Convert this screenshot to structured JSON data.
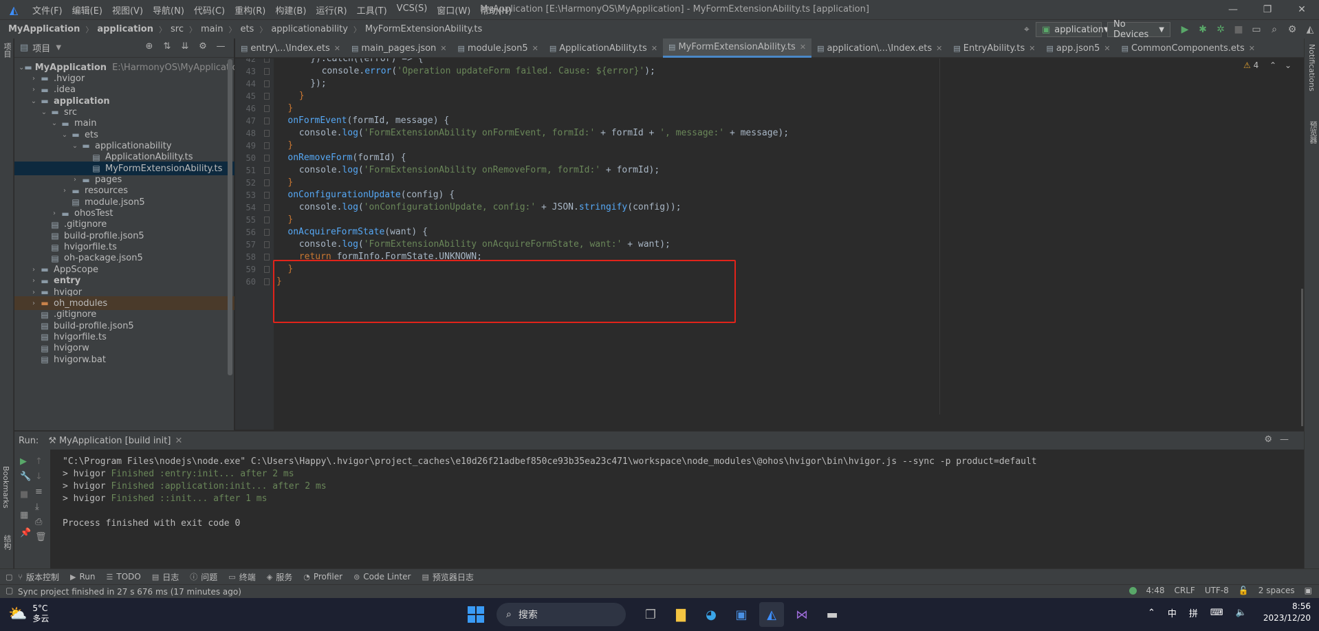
{
  "menubar": {
    "items": [
      "文件(F)",
      "编辑(E)",
      "视图(V)",
      "导航(N)",
      "代码(C)",
      "重构(R)",
      "构建(B)",
      "运行(R)",
      "工具(T)",
      "VCS(S)",
      "窗口(W)",
      "帮助(H)"
    ],
    "window_title": "MyApplication [E:\\HarmonyOS\\MyApplication] - MyFormExtensionAbility.ts [application]",
    "minimize": "—",
    "restore": "❐",
    "close": "✕"
  },
  "navbar": {
    "breadcrumbs": [
      "MyApplication",
      "application",
      "src",
      "main",
      "ets",
      "applicationability",
      "MyFormExtensionAbility.ts"
    ],
    "run_config": "application",
    "device": "No Devices"
  },
  "left_strip": {
    "project_tab": "项目",
    "bookmarks_tab": "Bookmarks",
    "structure_tab": "结构"
  },
  "right_strip": {
    "notifications_tab": "Notifications",
    "preview_tab": "预览器"
  },
  "project_panel": {
    "title": "项目",
    "tree": [
      {
        "label": "MyApplication",
        "path": "E:\\HarmonyOS\\MyApplication",
        "depth": 0,
        "type": "folder",
        "expanded": true,
        "bold": true
      },
      {
        "label": ".hvigor",
        "depth": 1,
        "type": "folder",
        "expanded": false
      },
      {
        "label": ".idea",
        "depth": 1,
        "type": "folder",
        "expanded": false
      },
      {
        "label": "application",
        "depth": 1,
        "type": "folder",
        "expanded": true,
        "bold": true
      },
      {
        "label": "src",
        "depth": 2,
        "type": "folder",
        "expanded": true
      },
      {
        "label": "main",
        "depth": 3,
        "type": "folder",
        "expanded": true
      },
      {
        "label": "ets",
        "depth": 4,
        "type": "folder",
        "expanded": true
      },
      {
        "label": "applicationability",
        "depth": 5,
        "type": "folder",
        "expanded": true
      },
      {
        "label": "ApplicationAbility.ts",
        "depth": 6,
        "type": "file"
      },
      {
        "label": "MyFormExtensionAbility.ts",
        "depth": 6,
        "type": "file",
        "selected": true
      },
      {
        "label": "pages",
        "depth": 5,
        "type": "folder",
        "expanded": false
      },
      {
        "label": "resources",
        "depth": 4,
        "type": "folder",
        "expanded": false
      },
      {
        "label": "module.json5",
        "depth": 4,
        "type": "file"
      },
      {
        "label": "ohosTest",
        "depth": 3,
        "type": "folder",
        "expanded": false
      },
      {
        "label": ".gitignore",
        "depth": 2,
        "type": "file"
      },
      {
        "label": "build-profile.json5",
        "depth": 2,
        "type": "file"
      },
      {
        "label": "hvigorfile.ts",
        "depth": 2,
        "type": "file"
      },
      {
        "label": "oh-package.json5",
        "depth": 2,
        "type": "file"
      },
      {
        "label": "AppScope",
        "depth": 1,
        "type": "folder",
        "expanded": false
      },
      {
        "label": "entry",
        "depth": 1,
        "type": "folder",
        "expanded": false,
        "bold": true
      },
      {
        "label": "hvigor",
        "depth": 1,
        "type": "folder",
        "expanded": false
      },
      {
        "label": "oh_modules",
        "depth": 1,
        "type": "folder",
        "expanded": false,
        "excluded": true
      },
      {
        "label": ".gitignore",
        "depth": 1,
        "type": "file"
      },
      {
        "label": "build-profile.json5",
        "depth": 1,
        "type": "file"
      },
      {
        "label": "hvigorfile.ts",
        "depth": 1,
        "type": "file"
      },
      {
        "label": "hvigorw",
        "depth": 1,
        "type": "file"
      },
      {
        "label": "hvigorw.bat",
        "depth": 1,
        "type": "file"
      }
    ]
  },
  "editor_tabs": [
    {
      "label": "entry\\...\\Index.ets",
      "active": false
    },
    {
      "label": "main_pages.json",
      "active": false
    },
    {
      "label": "module.json5",
      "active": false
    },
    {
      "label": "ApplicationAbility.ts",
      "active": false
    },
    {
      "label": "MyFormExtensionAbility.ts",
      "active": true
    },
    {
      "label": "application\\...\\Index.ets",
      "active": false
    },
    {
      "label": "EntryAbility.ts",
      "active": false
    },
    {
      "label": "app.json5",
      "active": false
    },
    {
      "label": "CommonComponents.ets",
      "active": false
    }
  ],
  "editor": {
    "warning_count": "4",
    "lines": [
      {
        "n": "42",
        "indent": 4,
        "tokens": [
          {
            "t": "}).catch((error) => {",
            "c": "plain"
          }
        ]
      },
      {
        "n": "43",
        "indent": 6,
        "tokens": [
          {
            "t": "console.",
            "c": "plain"
          },
          {
            "t": "error",
            "c": "fn"
          },
          {
            "t": "(",
            "c": "plain"
          },
          {
            "t": "'Operation updateForm failed. Cause: ${error}'",
            "c": "str"
          },
          {
            "t": ");",
            "c": "plain"
          }
        ]
      },
      {
        "n": "44",
        "indent": 4,
        "tokens": [
          {
            "t": "});",
            "c": "plain"
          }
        ]
      },
      {
        "n": "45",
        "indent": 2,
        "tokens": [
          {
            "t": "}",
            "c": "kw"
          }
        ]
      },
      {
        "n": "46",
        "indent": 0,
        "tokens": [
          {
            "t": "}",
            "c": "kw"
          }
        ]
      },
      {
        "n": "47",
        "indent": 0,
        "tokens": [
          {
            "t": "onFormEvent",
            "c": "fn"
          },
          {
            "t": "(formId, message) {",
            "c": "plain"
          }
        ]
      },
      {
        "n": "48",
        "indent": 2,
        "tokens": [
          {
            "t": "console.",
            "c": "plain"
          },
          {
            "t": "log",
            "c": "fn"
          },
          {
            "t": "(",
            "c": "plain"
          },
          {
            "t": "'FormExtensionAbility onFormEvent, formId:'",
            "c": "str"
          },
          {
            "t": " + formId + ",
            "c": "plain"
          },
          {
            "t": "', message:'",
            "c": "str"
          },
          {
            "t": " + message);",
            "c": "plain"
          }
        ]
      },
      {
        "n": "49",
        "indent": 0,
        "tokens": [
          {
            "t": "}",
            "c": "kw"
          }
        ]
      },
      {
        "n": "50",
        "indent": 0,
        "tokens": [
          {
            "t": "onRemoveForm",
            "c": "fn"
          },
          {
            "t": "(formId) {",
            "c": "plain"
          }
        ]
      },
      {
        "n": "51",
        "indent": 2,
        "tokens": [
          {
            "t": "console.",
            "c": "plain"
          },
          {
            "t": "log",
            "c": "fn"
          },
          {
            "t": "(",
            "c": "plain"
          },
          {
            "t": "'FormExtensionAbility onRemoveForm, formId:'",
            "c": "str"
          },
          {
            "t": " + formId);",
            "c": "plain"
          }
        ]
      },
      {
        "n": "52",
        "indent": 0,
        "tokens": [
          {
            "t": "}",
            "c": "kw"
          }
        ]
      },
      {
        "n": "53",
        "indent": 0,
        "tokens": [
          {
            "t": "onConfigurationUpdate",
            "c": "fn"
          },
          {
            "t": "(config) {",
            "c": "plain"
          }
        ]
      },
      {
        "n": "54",
        "indent": 2,
        "tokens": [
          {
            "t": "console.",
            "c": "plain"
          },
          {
            "t": "log",
            "c": "fn"
          },
          {
            "t": "(",
            "c": "plain"
          },
          {
            "t": "'onConfigurationUpdate, config:'",
            "c": "str"
          },
          {
            "t": " + JSON.",
            "c": "plain"
          },
          {
            "t": "stringify",
            "c": "fn"
          },
          {
            "t": "(config));",
            "c": "plain"
          }
        ]
      },
      {
        "n": "55",
        "indent": 0,
        "tokens": [
          {
            "t": "}",
            "c": "kw"
          }
        ]
      },
      {
        "n": "56",
        "indent": 0,
        "tokens": [
          {
            "t": "onAcquireFormState",
            "c": "fn"
          },
          {
            "t": "(want) {",
            "c": "plain"
          }
        ]
      },
      {
        "n": "57",
        "indent": 2,
        "tokens": [
          {
            "t": "console.",
            "c": "plain"
          },
          {
            "t": "log",
            "c": "fn"
          },
          {
            "t": "(",
            "c": "plain"
          },
          {
            "t": "'FormExtensionAbility onAcquireFormState, want:'",
            "c": "str"
          },
          {
            "t": " + want);",
            "c": "plain"
          }
        ]
      },
      {
        "n": "58",
        "indent": 2,
        "tokens": [
          {
            "t": "return ",
            "c": "kw"
          },
          {
            "t": "formInfo.FormState.UNKNOWN;",
            "c": "plain"
          }
        ]
      },
      {
        "n": "59",
        "indent": 0,
        "tokens": [
          {
            "t": "}",
            "c": "kw"
          }
        ]
      },
      {
        "n": "60",
        "indent": -2,
        "tokens": [
          {
            "t": "}",
            "c": "kw"
          }
        ]
      }
    ]
  },
  "run_panel": {
    "label": "Run:",
    "tab": "MyApplication [build init]",
    "output": [
      {
        "text": "\"C:\\Program Files\\nodejs\\node.exe\" C:\\Users\\Happy\\.hvigor\\project_caches\\e10d26f21adbef850ce93b35ea23c471\\workspace\\node_modules\\@ohos\\hvigor\\bin\\hvigor.js --sync -p product=default",
        "ok": ""
      },
      {
        "text": "> hvigor ",
        "ok": "Finished :entry:init... after 2 ms"
      },
      {
        "text": "> hvigor ",
        "ok": "Finished :application:init... after 2 ms"
      },
      {
        "text": "> hvigor ",
        "ok": "Finished ::init... after 1 ms"
      },
      {
        "text": "",
        "ok": ""
      },
      {
        "text": "Process finished with exit code 0",
        "ok": ""
      }
    ]
  },
  "tool_windows": [
    "版本控制",
    "Run",
    "TODO",
    "日志",
    "问题",
    "终端",
    "服务",
    "Profiler",
    "Code Linter",
    "预览器日志"
  ],
  "statusbar": {
    "message": "Sync project finished in 27 s 676 ms (17 minutes ago)",
    "position": "4:48",
    "line_sep": "CRLF",
    "encoding": "UTF-8",
    "indent": "2 spaces"
  },
  "taskbar": {
    "temperature": "5°C",
    "weather": "多云",
    "search_placeholder": "搜索",
    "ime_1": "中",
    "ime_2": "拼",
    "time": "8:56",
    "date": "2023/12/20"
  }
}
